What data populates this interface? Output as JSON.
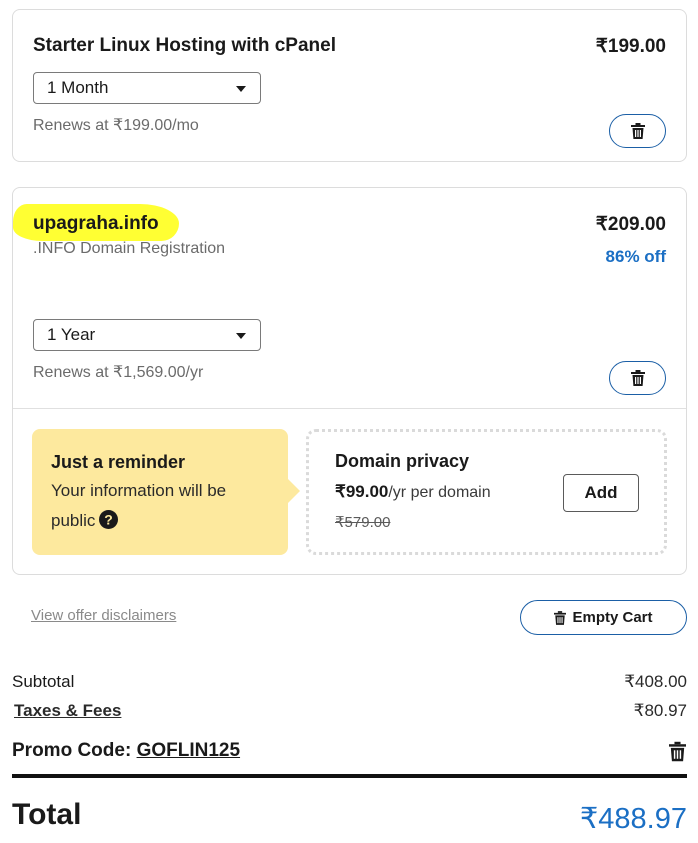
{
  "hosting": {
    "title": "Starter Linux Hosting with cPanel",
    "price": "₹199.00",
    "term": "1 Month",
    "renews": "Renews at ₹199.00/mo"
  },
  "domain": {
    "name": "upagraha.info",
    "description": ".INFO Domain Registration",
    "price": "₹209.00",
    "discount": "86% off",
    "term": "1 Year",
    "renews": "Renews at ₹1,569.00/yr"
  },
  "reminder": {
    "title": "Just a reminder",
    "text": "Your information will be public"
  },
  "privacy": {
    "title": "Domain privacy",
    "price": "₹99.00",
    "price_suffix": "/yr per domain",
    "old_price": "₹579.00",
    "add_label": "Add"
  },
  "links": {
    "disclaimers": "View offer disclaimers",
    "empty_cart": "Empty Cart"
  },
  "summary": {
    "subtotal_label": "Subtotal",
    "subtotal_value": "₹408.00",
    "taxes_label": "Taxes & Fees",
    "taxes_value": "₹80.97",
    "promo_label": "Promo Code:",
    "promo_code": "GOFLIN125",
    "total_label": "Total",
    "total_value": "₹488.97"
  },
  "colors": {
    "accent_blue": "#1b6fc4",
    "button_border": "#1b5fa6",
    "reminder_bg": "#fde99e",
    "highlight": "#ffff33"
  },
  "icons": {
    "delete": "trash-icon",
    "dropdown": "caret-down-icon",
    "help": "question-circle-icon"
  }
}
